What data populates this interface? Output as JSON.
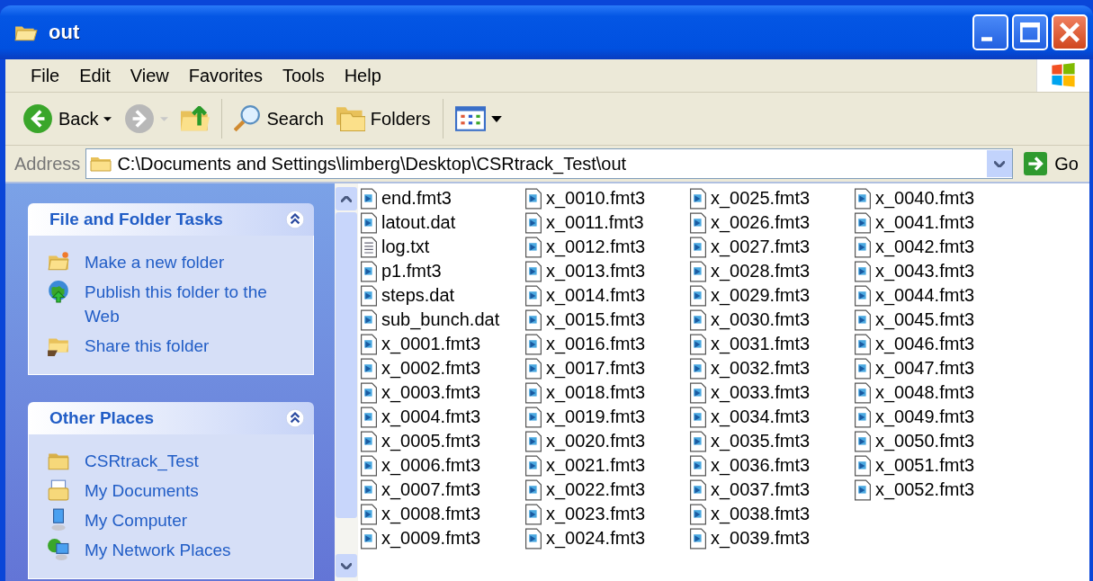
{
  "window": {
    "title": "out"
  },
  "menu": [
    "File",
    "Edit",
    "View",
    "Favorites",
    "Tools",
    "Help"
  ],
  "toolbar": [
    {
      "kind": "back",
      "label": "Back"
    },
    {
      "kind": "forward",
      "disabled": true
    },
    {
      "kind": "up"
    },
    {
      "kind": "separator"
    },
    {
      "kind": "search",
      "label": "Search"
    },
    {
      "kind": "folders",
      "label": "Folders"
    },
    {
      "kind": "separator"
    },
    {
      "kind": "views"
    }
  ],
  "address": {
    "label": "Address",
    "value": "C:\\Documents and Settings\\limberg\\Desktop\\CSRtrack_Test\\out",
    "go": "Go"
  },
  "sidebar": [
    {
      "title": "File and Folder Tasks",
      "expanded": true,
      "items": [
        {
          "label": "Make a new folder",
          "kind": "new-folder"
        },
        {
          "label": "Publish this folder to the Web",
          "kind": "publish"
        },
        {
          "label": "Share this folder",
          "kind": "share"
        }
      ]
    },
    {
      "title": "Other Places",
      "expanded": true,
      "items": [
        {
          "label": "CSRtrack_Test",
          "kind": "folder"
        },
        {
          "label": "My Documents",
          "kind": "documents"
        },
        {
          "label": "My Computer",
          "kind": "computer"
        },
        {
          "label": "My Network Places",
          "kind": "network"
        }
      ]
    }
  ],
  "files": [
    {
      "name": "end.fmt3",
      "kind": "data"
    },
    {
      "name": "latout.dat",
      "kind": "data"
    },
    {
      "name": "log.txt",
      "kind": "text"
    },
    {
      "name": "p1.fmt3",
      "kind": "data"
    },
    {
      "name": "steps.dat",
      "kind": "data"
    },
    {
      "name": "sub_bunch.dat",
      "kind": "data"
    },
    {
      "name": "x_0001.fmt3",
      "kind": "data"
    },
    {
      "name": "x_0002.fmt3",
      "kind": "data"
    },
    {
      "name": "x_0003.fmt3",
      "kind": "data"
    },
    {
      "name": "x_0004.fmt3",
      "kind": "data"
    },
    {
      "name": "x_0005.fmt3",
      "kind": "data"
    },
    {
      "name": "x_0006.fmt3",
      "kind": "data"
    },
    {
      "name": "x_0007.fmt3",
      "kind": "data"
    },
    {
      "name": "x_0008.fmt3",
      "kind": "data"
    },
    {
      "name": "x_0009.fmt3",
      "kind": "data"
    },
    {
      "name": "x_0010.fmt3",
      "kind": "data"
    },
    {
      "name": "x_0011.fmt3",
      "kind": "data"
    },
    {
      "name": "x_0012.fmt3",
      "kind": "data"
    },
    {
      "name": "x_0013.fmt3",
      "kind": "data"
    },
    {
      "name": "x_0014.fmt3",
      "kind": "data"
    },
    {
      "name": "x_0015.fmt3",
      "kind": "data"
    },
    {
      "name": "x_0016.fmt3",
      "kind": "data"
    },
    {
      "name": "x_0017.fmt3",
      "kind": "data"
    },
    {
      "name": "x_0018.fmt3",
      "kind": "data"
    },
    {
      "name": "x_0019.fmt3",
      "kind": "data"
    },
    {
      "name": "x_0020.fmt3",
      "kind": "data"
    },
    {
      "name": "x_0021.fmt3",
      "kind": "data"
    },
    {
      "name": "x_0022.fmt3",
      "kind": "data"
    },
    {
      "name": "x_0023.fmt3",
      "kind": "data"
    },
    {
      "name": "x_0024.fmt3",
      "kind": "data"
    },
    {
      "name": "x_0025.fmt3",
      "kind": "data"
    },
    {
      "name": "x_0026.fmt3",
      "kind": "data"
    },
    {
      "name": "x_0027.fmt3",
      "kind": "data"
    },
    {
      "name": "x_0028.fmt3",
      "kind": "data"
    },
    {
      "name": "x_0029.fmt3",
      "kind": "data"
    },
    {
      "name": "x_0030.fmt3",
      "kind": "data"
    },
    {
      "name": "x_0031.fmt3",
      "kind": "data"
    },
    {
      "name": "x_0032.fmt3",
      "kind": "data"
    },
    {
      "name": "x_0033.fmt3",
      "kind": "data"
    },
    {
      "name": "x_0034.fmt3",
      "kind": "data"
    },
    {
      "name": "x_0035.fmt3",
      "kind": "data"
    },
    {
      "name": "x_0036.fmt3",
      "kind": "data"
    },
    {
      "name": "x_0037.fmt3",
      "kind": "data"
    },
    {
      "name": "x_0038.fmt3",
      "kind": "data"
    },
    {
      "name": "x_0039.fmt3",
      "kind": "data"
    },
    {
      "name": "x_0040.fmt3",
      "kind": "data"
    },
    {
      "name": "x_0041.fmt3",
      "kind": "data"
    },
    {
      "name": "x_0042.fmt3",
      "kind": "data"
    },
    {
      "name": "x_0043.fmt3",
      "kind": "data"
    },
    {
      "name": "x_0044.fmt3",
      "kind": "data"
    },
    {
      "name": "x_0045.fmt3",
      "kind": "data"
    },
    {
      "name": "x_0046.fmt3",
      "kind": "data"
    },
    {
      "name": "x_0047.fmt3",
      "kind": "data"
    },
    {
      "name": "x_0048.fmt3",
      "kind": "data"
    },
    {
      "name": "x_0049.fmt3",
      "kind": "data"
    },
    {
      "name": "x_0050.fmt3",
      "kind": "data"
    },
    {
      "name": "x_0051.fmt3",
      "kind": "data"
    },
    {
      "name": "x_0052.fmt3",
      "kind": "data"
    }
  ]
}
